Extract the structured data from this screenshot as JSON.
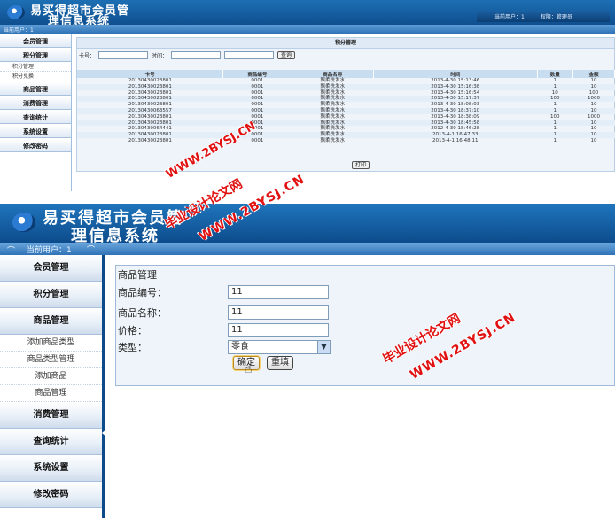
{
  "app": {
    "title_line1": "易买得超市会员管",
    "title_line2": "理信息系统"
  },
  "top": {
    "header_info": [
      "当前用户：1",
      "权限：管理员"
    ],
    "current_user": "当前用户：1",
    "sidebar": [
      {
        "label": "会员管理"
      },
      {
        "label": "积分管理"
      },
      {
        "label": "积分管理",
        "sub": true
      },
      {
        "label": "积分兑换",
        "sub": true
      },
      {
        "label": "商品管理"
      },
      {
        "label": "消费管理"
      },
      {
        "label": "查询统计"
      },
      {
        "label": "系统设置"
      },
      {
        "label": "修改密码"
      }
    ],
    "panel_title": "积分管理",
    "search": {
      "card_label": "卡号：",
      "time_label": "时间：",
      "button": "查询"
    },
    "table": {
      "headers": [
        "卡号",
        "商品编号",
        "商品名称",
        "时间",
        "数量",
        "金额"
      ],
      "rows": [
        [
          "20130430023801",
          "0001",
          "飘柔洗发水",
          "2013-4-30 15:13:46",
          "1",
          "10"
        ],
        [
          "20130430023801",
          "0001",
          "飘柔洗发水",
          "2013-4-30 15:16:38",
          "1",
          "10"
        ],
        [
          "20130430023801",
          "0001",
          "飘柔洗发水",
          "2013-4-30 15:16:54",
          "10",
          "100"
        ],
        [
          "20130430023801",
          "0001",
          "飘柔洗发水",
          "2013-4-30 15:17:37",
          "100",
          "1000"
        ],
        [
          "20130430023801",
          "0001",
          "飘柔洗发水",
          "2013-4-30 18:08:03",
          "1",
          "10"
        ],
        [
          "20130430063557",
          "0001",
          "飘柔洗发水",
          "2013-4-30 18:37:10",
          "1",
          "10"
        ],
        [
          "20130430023801",
          "0001",
          "飘柔洗发水",
          "2013-4-30 18:38:09",
          "100",
          "1000"
        ],
        [
          "20130430023801",
          "0001",
          "飘柔洗发水",
          "2013-4-30 18:45:58",
          "1",
          "10"
        ],
        [
          "20130430064441",
          "0001",
          "飘柔洗发水",
          "2012-4-30 18:46:28",
          "1",
          "10"
        ],
        [
          "20130430023801",
          "0001",
          "飘柔洗发水",
          "2013-4-1 16:47:33",
          "1",
          "10"
        ],
        [
          "20130430023801",
          "0001",
          "飘柔洗发水",
          "2013-4-1 16:48:11",
          "1",
          "10"
        ]
      ]
    },
    "print_button": "打印"
  },
  "bottom": {
    "current_user": "当前用户：1",
    "sidebar": [
      {
        "label": "会员管理"
      },
      {
        "label": "积分管理"
      },
      {
        "label": "商品管理"
      },
      {
        "label": "添加商品类型",
        "sub": true
      },
      {
        "label": "商品类型管理",
        "sub": true
      },
      {
        "label": "添加商品",
        "sub": true
      },
      {
        "label": "商品管理",
        "sub": true
      },
      {
        "label": "消费管理"
      },
      {
        "label": "查询统计"
      },
      {
        "label": "系统设置"
      },
      {
        "label": "修改密码"
      }
    ],
    "form": {
      "title": "商品管理",
      "code_label": "商品编号：",
      "code_value": "11",
      "name_label": "商品名称：",
      "name_value": "11",
      "price_label": "价格：",
      "price_value": "11",
      "type_label": "类型：",
      "type_value": "零食",
      "ok_button": "确定",
      "reset_button": "重填"
    }
  },
  "watermark": {
    "url": "WWW.2BYSJ.CN",
    "text": "毕业设计论文网"
  }
}
